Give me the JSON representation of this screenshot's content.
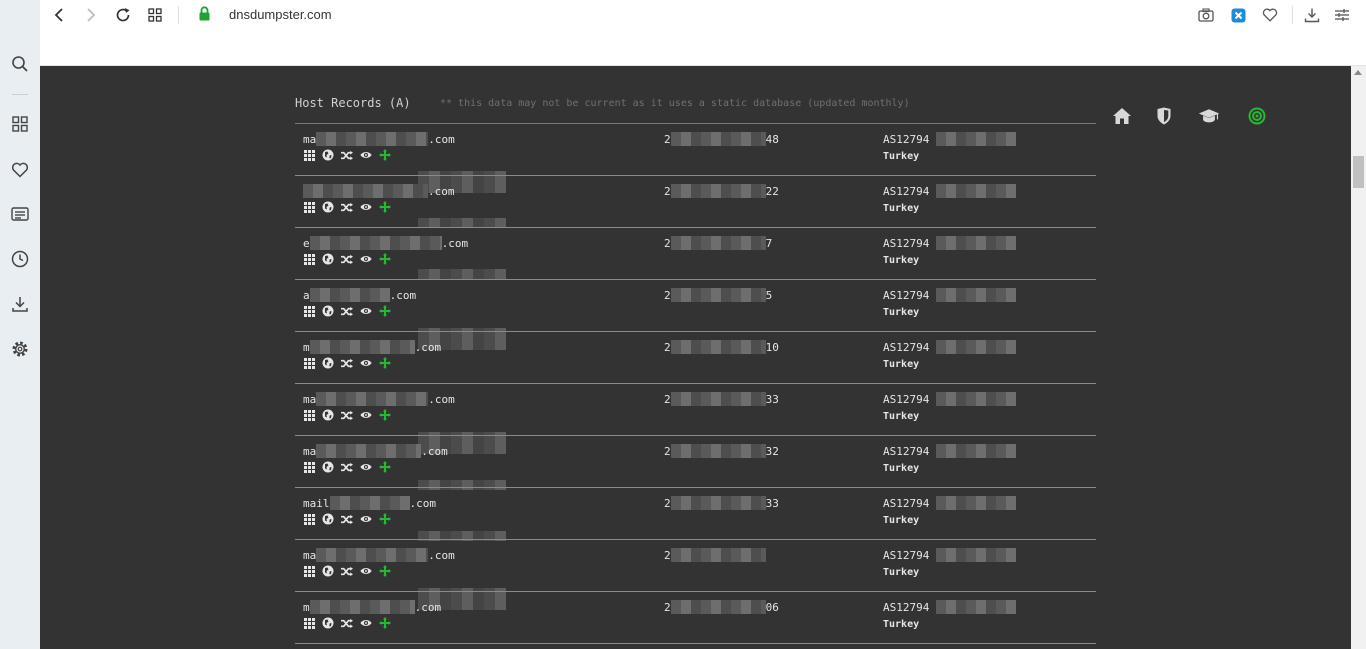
{
  "browser": {
    "url": "dnsdumpster.com",
    "icons": {
      "back": "chevron-left-icon",
      "forward": "chevron-right-icon",
      "reload": "reload-icon",
      "tabs": "grid-icon",
      "lock": "lock-icon",
      "snapshot": "camera-icon",
      "extension": "extension-icon",
      "bookmark": "heart-icon",
      "download": "download-icon",
      "menu": "menu-icon"
    }
  },
  "sidebar": {
    "items": [
      "search-icon",
      "speed-dial-icon",
      "heart-icon",
      "news-icon",
      "history-icon",
      "download-icon",
      "settings-icon"
    ]
  },
  "site": {
    "nav_icons": [
      "home-icon",
      "shield-icon",
      "graduation-cap-icon",
      "target-icon"
    ],
    "section_title": "Host Records (A)",
    "section_note": "** this data may not be current as it uses a static database (updated monthly)",
    "colors": {
      "accent_green": "#22bb33",
      "background": "#333333"
    }
  },
  "records": [
    {
      "host_start": "ma",
      "host_end": ".com",
      "ip_start": "2",
      "ip_end": "48",
      "asn": "AS12794",
      "country": "Turkey"
    },
    {
      "host_start": "",
      "host_end": ".com",
      "ip_start": "2",
      "ip_end": "22",
      "asn": "AS12794",
      "country": "Turkey"
    },
    {
      "host_start": "e",
      "host_end": ".com",
      "ip_start": "2",
      "ip_end": "7",
      "asn": "AS12794",
      "country": "Turkey"
    },
    {
      "host_start": "a",
      "host_end": ".com",
      "ip_start": "2",
      "ip_end": "5",
      "asn": "AS12794",
      "country": "Turkey"
    },
    {
      "host_start": "m",
      "host_end": ".com",
      "ip_start": "2",
      "ip_end": "10",
      "asn": "AS12794",
      "country": "Turkey"
    },
    {
      "host_start": "ma",
      "host_end": ".com",
      "ip_start": "2",
      "ip_end": "33",
      "asn": "AS12794",
      "country": "Turkey"
    },
    {
      "host_start": "ma",
      "host_end": ".com",
      "ip_start": "2",
      "ip_end": "32",
      "asn": "AS12794",
      "country": "Turkey"
    },
    {
      "host_start": "mail",
      "host_end": ".com",
      "ip_start": "2",
      "ip_end": "33",
      "asn": "AS12794",
      "country": "Turkey"
    },
    {
      "host_start": "ma",
      "host_end": ".com",
      "ip_start": "2",
      "ip_end": "",
      "asn": "AS12794",
      "country": "Turkey"
    },
    {
      "host_start": "m",
      "host_end": ".com",
      "ip_start": "2",
      "ip_end": "06",
      "asn": "AS12794",
      "country": "Turkey"
    }
  ]
}
